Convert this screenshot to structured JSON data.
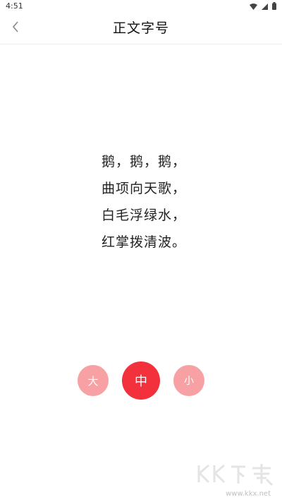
{
  "status_bar": {
    "time": "4:51",
    "icons": [
      "wifi-icon",
      "signal-icon",
      "battery-icon"
    ]
  },
  "header": {
    "title": "正文字号",
    "back_icon": "chevron-left-icon"
  },
  "poem": {
    "lines": [
      "鹅，鹅，鹅，",
      "曲项向天歌，",
      "白毛浮绿水，",
      "红掌拨清波。"
    ]
  },
  "size_options": {
    "large": "大",
    "medium": "中",
    "small": "小",
    "selected": "medium"
  },
  "watermark": {
    "logo_text": "KK下载",
    "url": "www.kkx.net"
  },
  "colors": {
    "accent": "#f2313d",
    "accent_light": "#f7a1a5"
  }
}
